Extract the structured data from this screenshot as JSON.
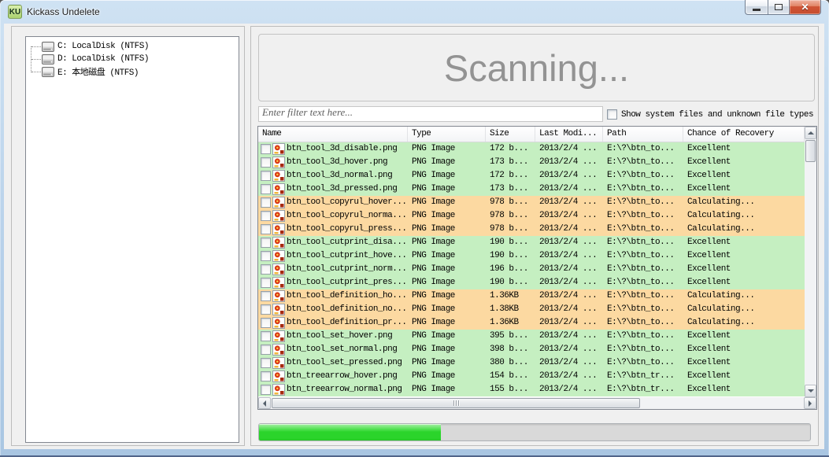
{
  "window": {
    "title": "Kickass Undelete",
    "icon_label": "KU",
    "close_glyph": "✕"
  },
  "drive_tree": {
    "items": [
      {
        "label": "C: LocalDisk (NTFS)"
      },
      {
        "label": "D: LocalDisk (NTFS)"
      },
      {
        "label": "E: 本地磁盘 (NTFS)"
      }
    ]
  },
  "scan_status": {
    "text": "Scanning..."
  },
  "filter": {
    "placeholder": "Enter filter text here...",
    "value": ""
  },
  "options": {
    "show_system_label": "Show system files and unknown file types",
    "show_system_checked": false
  },
  "file_table": {
    "columns": [
      "Name",
      "Type",
      "Size",
      "Last Modi...",
      "Path",
      "Chance of Recovery"
    ],
    "rows": [
      {
        "name": "btn_tool_3d_disable.png",
        "type": "PNG Image",
        "size": "172 b...",
        "modified": "2013/2/4 ...",
        "path": "E:\\?\\btn_to...",
        "chance": "Excellent",
        "status": "excellent"
      },
      {
        "name": "btn_tool_3d_hover.png",
        "type": "PNG Image",
        "size": "173 b...",
        "modified": "2013/2/4 ...",
        "path": "E:\\?\\btn_to...",
        "chance": "Excellent",
        "status": "excellent"
      },
      {
        "name": "btn_tool_3d_normal.png",
        "type": "PNG Image",
        "size": "172 b...",
        "modified": "2013/2/4 ...",
        "path": "E:\\?\\btn_to...",
        "chance": "Excellent",
        "status": "excellent"
      },
      {
        "name": "btn_tool_3d_pressed.png",
        "type": "PNG Image",
        "size": "173 b...",
        "modified": "2013/2/4 ...",
        "path": "E:\\?\\btn_to...",
        "chance": "Excellent",
        "status": "excellent"
      },
      {
        "name": "btn_tool_copyrul_hover...",
        "type": "PNG Image",
        "size": "978 b...",
        "modified": "2013/2/4 ...",
        "path": "E:\\?\\btn_to...",
        "chance": "Calculating...",
        "status": "calculating"
      },
      {
        "name": "btn_tool_copyrul_norma...",
        "type": "PNG Image",
        "size": "978 b...",
        "modified": "2013/2/4 ...",
        "path": "E:\\?\\btn_to...",
        "chance": "Calculating...",
        "status": "calculating"
      },
      {
        "name": "btn_tool_copyrul_press...",
        "type": "PNG Image",
        "size": "978 b...",
        "modified": "2013/2/4 ...",
        "path": "E:\\?\\btn_to...",
        "chance": "Calculating...",
        "status": "calculating"
      },
      {
        "name": "btn_tool_cutprint_disa...",
        "type": "PNG Image",
        "size": "190 b...",
        "modified": "2013/2/4 ...",
        "path": "E:\\?\\btn_to...",
        "chance": "Excellent",
        "status": "excellent"
      },
      {
        "name": "btn_tool_cutprint_hove...",
        "type": "PNG Image",
        "size": "190 b...",
        "modified": "2013/2/4 ...",
        "path": "E:\\?\\btn_to...",
        "chance": "Excellent",
        "status": "excellent"
      },
      {
        "name": "btn_tool_cutprint_norm...",
        "type": "PNG Image",
        "size": "196 b...",
        "modified": "2013/2/4 ...",
        "path": "E:\\?\\btn_to...",
        "chance": "Excellent",
        "status": "excellent"
      },
      {
        "name": "btn_tool_cutprint_pres...",
        "type": "PNG Image",
        "size": "190 b...",
        "modified": "2013/2/4 ...",
        "path": "E:\\?\\btn_to...",
        "chance": "Excellent",
        "status": "excellent"
      },
      {
        "name": "btn_tool_definition_ho...",
        "type": "PNG Image",
        "size": "1.36KB",
        "modified": "2013/2/4 ...",
        "path": "E:\\?\\btn_to...",
        "chance": "Calculating...",
        "status": "calculating"
      },
      {
        "name": "btn_tool_definition_no...",
        "type": "PNG Image",
        "size": "1.38KB",
        "modified": "2013/2/4 ...",
        "path": "E:\\?\\btn_to...",
        "chance": "Calculating...",
        "status": "calculating"
      },
      {
        "name": "btn_tool_definition_pr...",
        "type": "PNG Image",
        "size": "1.36KB",
        "modified": "2013/2/4 ...",
        "path": "E:\\?\\btn_to...",
        "chance": "Calculating...",
        "status": "calculating"
      },
      {
        "name": "btn_tool_set_hover.png",
        "type": "PNG Image",
        "size": "395 b...",
        "modified": "2013/2/4 ...",
        "path": "E:\\?\\btn_to...",
        "chance": "Excellent",
        "status": "excellent"
      },
      {
        "name": "btn_tool_set_normal.png",
        "type": "PNG Image",
        "size": "398 b...",
        "modified": "2013/2/4 ...",
        "path": "E:\\?\\btn_to...",
        "chance": "Excellent",
        "status": "excellent"
      },
      {
        "name": "btn_tool_set_pressed.png",
        "type": "PNG Image",
        "size": "380 b...",
        "modified": "2013/2/4 ...",
        "path": "E:\\?\\btn_to...",
        "chance": "Excellent",
        "status": "excellent"
      },
      {
        "name": "btn_treearrow_hover.png",
        "type": "PNG Image",
        "size": "154 b...",
        "modified": "2013/2/4 ...",
        "path": "E:\\?\\btn_tr...",
        "chance": "Excellent",
        "status": "excellent"
      },
      {
        "name": "btn_treearrow_normal.png",
        "type": "PNG Image",
        "size": "155 b...",
        "modified": "2013/2/4 ...",
        "path": "E:\\?\\btn_tr...",
        "chance": "Excellent",
        "status": "excellent"
      }
    ]
  },
  "progress": {
    "percent": 33
  },
  "colors": {
    "row_excellent": "#c5efc1",
    "row_calculating": "#fcd9a1",
    "progress_fill": "#2bd42b"
  }
}
